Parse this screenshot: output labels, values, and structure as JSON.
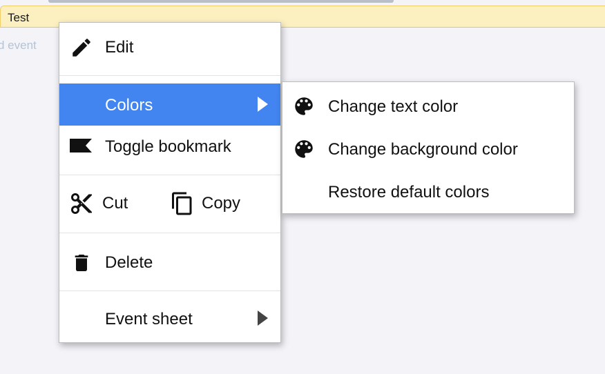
{
  "tab": {
    "label": "Test"
  },
  "hint": {
    "text": "d event"
  },
  "context_menu": {
    "edit": {
      "label": "Edit",
      "icon": "pencil-icon"
    },
    "colors": {
      "label": "Colors",
      "highlighted": true,
      "highlight_color": "#4285f0"
    },
    "toggle_bookmark": {
      "label": "Toggle bookmark",
      "icon": "bookmark-icon"
    },
    "cut": {
      "label": "Cut",
      "icon": "scissors-icon"
    },
    "copy": {
      "label": "Copy",
      "icon": "copy-icon"
    },
    "delete": {
      "label": "Delete",
      "icon": "trash-icon"
    },
    "event_sheet": {
      "label": "Event sheet"
    }
  },
  "colors_submenu": {
    "change_text_color": {
      "label": "Change text color",
      "icon": "palette-icon"
    },
    "change_background_color": {
      "label": "Change background color",
      "icon": "palette-icon"
    },
    "restore_default_colors": {
      "label": "Restore default colors"
    }
  }
}
